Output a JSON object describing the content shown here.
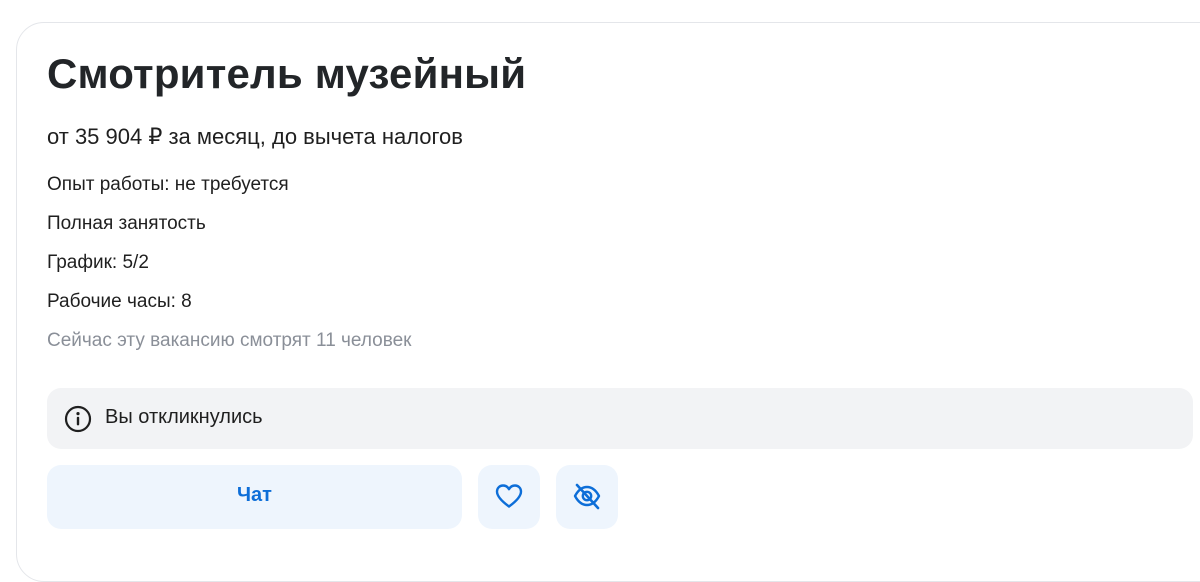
{
  "vacancy": {
    "title": "Смотритель музейный",
    "salary": "от 35 904 ₽ за месяц, до вычета налогов",
    "experience": "Опыт работы: не требуется",
    "employment": "Полная занятость",
    "schedule": "График: 5/2",
    "hours": "Рабочие часы: 8",
    "viewers": "Сейчас эту вакансию смотрят 11 человек"
  },
  "notice": {
    "icon": "info-icon",
    "text": "Вы откликнулись"
  },
  "actions": {
    "chat_label": "Чат",
    "favorite_icon": "heart-icon",
    "hide_icon": "eye-off-icon",
    "accent_color": "#0d6ed8",
    "button_bg": "#eef5fd"
  }
}
